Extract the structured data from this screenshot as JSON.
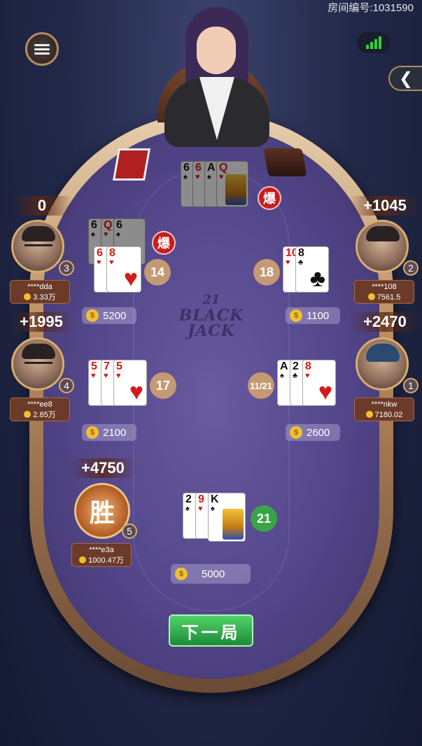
{
  "header": {
    "room_id": "房间编号:1031590"
  },
  "table": {
    "logo_number": "21",
    "logo_word1": "BLACK",
    "logo_word2": "JACK",
    "bust_label": "爆",
    "win_label": "胜"
  },
  "dealer": {
    "cards": [
      {
        "rank": "6",
        "suit": "♠"
      },
      {
        "rank": "6",
        "suit": "♥"
      },
      {
        "rank": "A",
        "suit": "♠"
      },
      {
        "rank": "Q",
        "suit": "♥"
      }
    ],
    "bust": "爆"
  },
  "players": {
    "p3": {
      "gain": "0",
      "name": "****dda",
      "balance": "3.33万",
      "seat": "3",
      "bet": "5200",
      "score": "14",
      "bust": "爆"
    },
    "p4": {
      "gain": "+1995",
      "name": "****ee8",
      "balance": "2.85万",
      "seat": "4",
      "bet": "2100",
      "score": "17"
    },
    "p5": {
      "gain": "+4750",
      "name": "****e3a",
      "balance": "1000.47万",
      "seat": "5"
    },
    "p2": {
      "gain": "+1045",
      "name": "****108",
      "balance": "7561.5",
      "seat": "2",
      "bet": "1100",
      "score": "18"
    },
    "p1": {
      "gain": "+2470",
      "name": "****nkw",
      "balance": "7180.02",
      "seat": "1",
      "bet": "2600",
      "score": "11/21"
    },
    "me": {
      "bet": "5000",
      "score": "21"
    }
  },
  "actions": {
    "next_round": "下一局"
  },
  "colors": {
    "felt": "#53468a",
    "rim": "#b88a5f",
    "accent_green": "#3aa34a",
    "bust_red": "#c81d1d"
  }
}
